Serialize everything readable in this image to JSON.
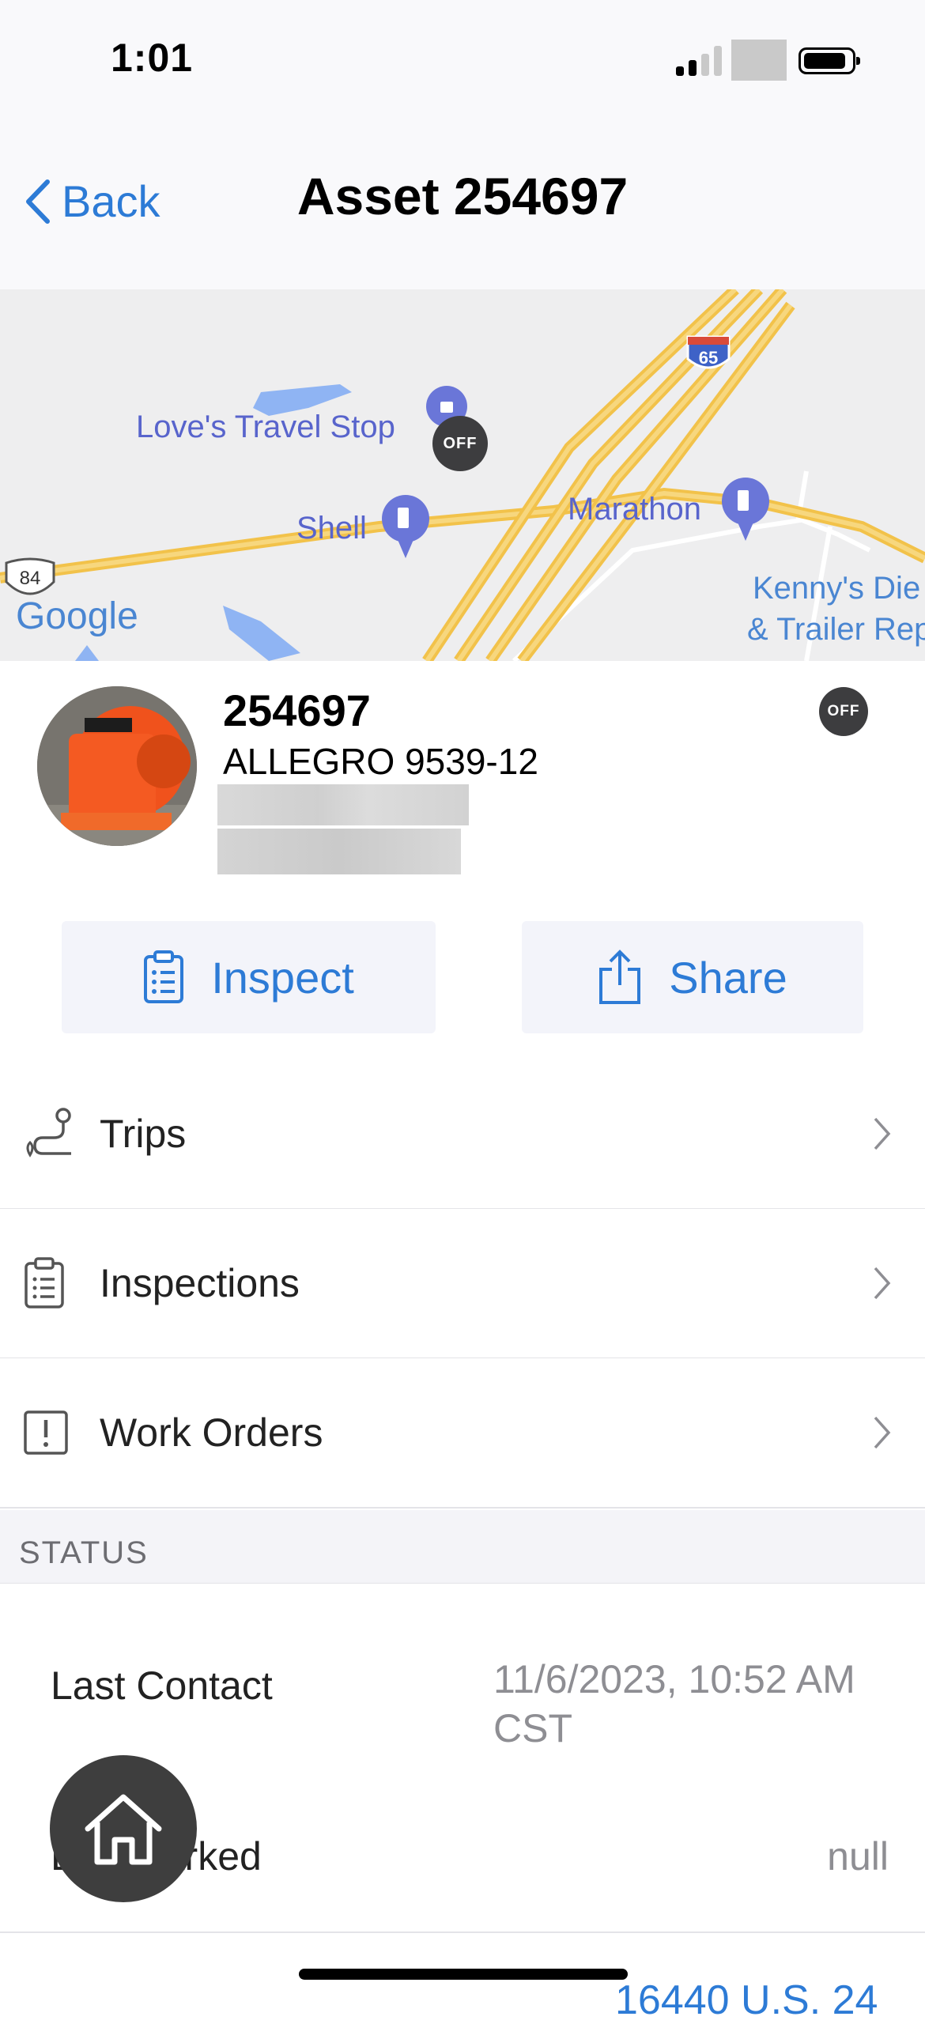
{
  "status_bar": {
    "time": "1:01"
  },
  "nav": {
    "back_label": "Back",
    "title": "Asset 254697"
  },
  "map": {
    "attribution": "Google",
    "labels": {
      "loves": "Love's Travel Stop",
      "shell": "Shell",
      "marathon": "Marathon",
      "kennys_line1": "Kenny's Die",
      "kennys_line2": "& Trailer Rep",
      "highway_65": "65",
      "route_84": "84"
    },
    "marker_badge": "OFF"
  },
  "asset": {
    "id": "254697",
    "model": "ALLEGRO 9539-12",
    "status_badge": "OFF"
  },
  "actions": {
    "inspect": "Inspect",
    "share": "Share"
  },
  "menu": [
    {
      "label": "Trips",
      "icon": "route-icon"
    },
    {
      "label": "Inspections",
      "icon": "clipboard-icon"
    },
    {
      "label": "Work Orders",
      "icon": "alert-square-icon"
    }
  ],
  "status_section": {
    "header": "STATUS",
    "last_contact_label": "Last Contact",
    "last_contact_value_line1": "11/6/2023, 10:52 AM",
    "last_contact_value_line2": "CST",
    "last_parked_label": "Last Parked",
    "last_parked_value": "null",
    "address_partial": "16440 U.S. 24"
  },
  "colors": {
    "accent": "#2d7bd6",
    "road": "#f6c94a",
    "badge": "#3d3d3f"
  }
}
